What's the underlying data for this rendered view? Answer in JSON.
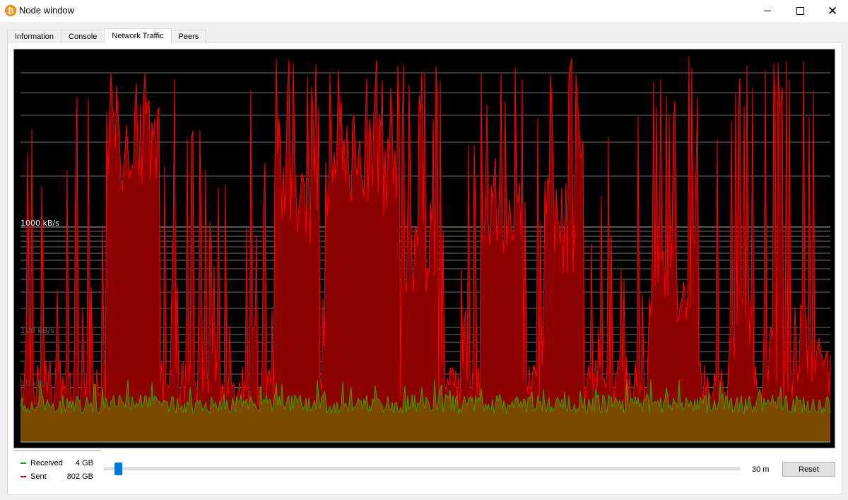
{
  "window": {
    "title": "Node window",
    "icon": "bitcoin-icon",
    "icon_glyph": "₿"
  },
  "tabs": [
    {
      "label": "Information"
    },
    {
      "label": "Console"
    },
    {
      "label": "Network Traffic",
      "active": true
    },
    {
      "label": "Peers"
    }
  ],
  "graph": {
    "background": "#000000",
    "scale_labels": [
      "1000 kB/s",
      "100 kB/s",
      "10 kB/s"
    ],
    "scale_label_colors": [
      "#ffffff",
      "#5a5a5a",
      "#4a4a4a"
    ],
    "sent_color": "#ff0000",
    "sent_fill": "#8c0000",
    "received_color": "#00ff00",
    "received_fill": "#7a4a00"
  },
  "legend": {
    "received_label": "Received",
    "received_total": "4 GB",
    "received_color": "#00aa00",
    "sent_label": "Sent",
    "sent_total": "802 GB",
    "sent_color": "#cc0000"
  },
  "controls": {
    "range_label": "30 m",
    "reset_label": "Reset",
    "slider_position": 0.02
  }
}
